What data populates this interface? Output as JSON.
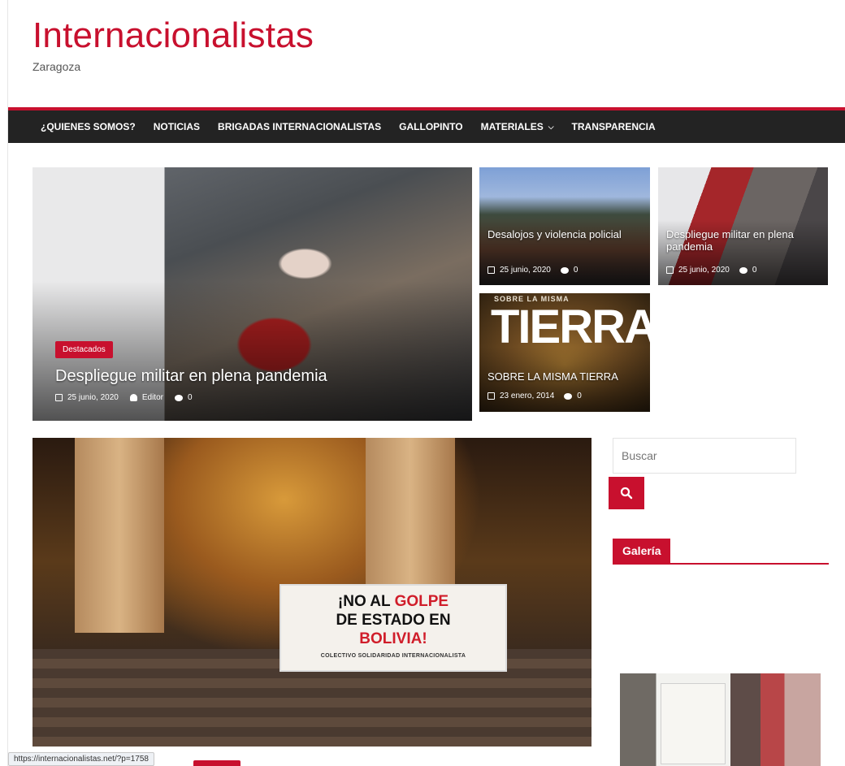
{
  "site": {
    "title": "Internacionalistas",
    "tagline": "Zaragoza"
  },
  "nav": {
    "items": [
      {
        "label": "¿QUIENES SOMOS?"
      },
      {
        "label": "NOTICIAS"
      },
      {
        "label": "BRIGADAS INTERNACIONALISTAS"
      },
      {
        "label": "GALLOPINTO"
      },
      {
        "label": "MATERIALES",
        "chevron": "chevron-down-icon"
      },
      {
        "label": "TRANSPARENCIA"
      }
    ]
  },
  "featured": {
    "big": {
      "category": "Destacados",
      "title": "Despliegue militar en plena pandemia",
      "date": "25 junio, 2020",
      "author": "Editor",
      "comments": "0"
    },
    "small": [
      {
        "title": "Desalojos y violencia policial",
        "date": "25 junio, 2020",
        "comments": "0"
      },
      {
        "title": "Despliegue militar en plena pandemia",
        "date": "25 junio, 2020",
        "comments": "0"
      },
      {
        "title": "SOBRE LA MISMA TIERRA",
        "date": "23 enero, 2014",
        "comments": "0",
        "image_heading_top": "SOBRE LA MISMA",
        "image_heading": "TIERRA"
      }
    ]
  },
  "main_photo": {
    "banner_line1_a": "¡NO AL ",
    "banner_line1_b": "GOLPE",
    "banner_line2": "DE ESTADO EN",
    "banner_line3": "BOLIVIA!",
    "banner_small": "COLECTIVO SOLIDARIDAD INTERNACIONALISTA"
  },
  "sidebar": {
    "search_placeholder": "Buscar",
    "search_icon": "search-icon",
    "gallery_title": "Galería"
  },
  "status_bar": {
    "url": "https://internacionalistas.net/?p=1758"
  },
  "colors": {
    "accent": "#c8102e",
    "nav_bg": "#232323"
  }
}
